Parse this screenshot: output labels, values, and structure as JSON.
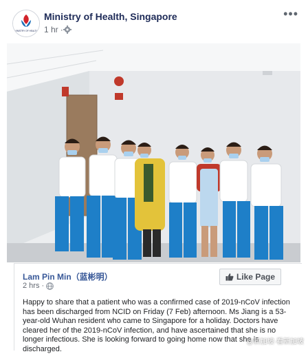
{
  "header": {
    "page_name": "Ministry of Health, Singapore",
    "time": "1 hr",
    "dot": "·",
    "more_label": "•••",
    "avatar_text": "MINISTRY OF HEALTH"
  },
  "photo": {
    "icons": [
      "people-group-photo"
    ]
  },
  "shared_post": {
    "author": "Lam Pin Min（蓝彬明）",
    "time": "2 hrs",
    "dot": "·",
    "like_button": "Like Page",
    "text": "Happy to share that a patient who was a confirmed case of 2019-nCoV infection has been discharged from NCID on Friday (7 Feb) afternoon. Ms Jiang is a 53-year-old Wuhan resident who came to Singapore for a holiday. Doctors have cleared her of the 2019-nCoV infection, and have ascertained that she is no longer infectious. She is looking forward to going home now that she is discharged."
  },
  "watermark": "@新加坡·看新加坡",
  "colors": {
    "brand": "#1d2a57",
    "link": "#385898",
    "uniform_blue": "#1e7fc8",
    "yellow_jacket": "#e3c33a"
  }
}
